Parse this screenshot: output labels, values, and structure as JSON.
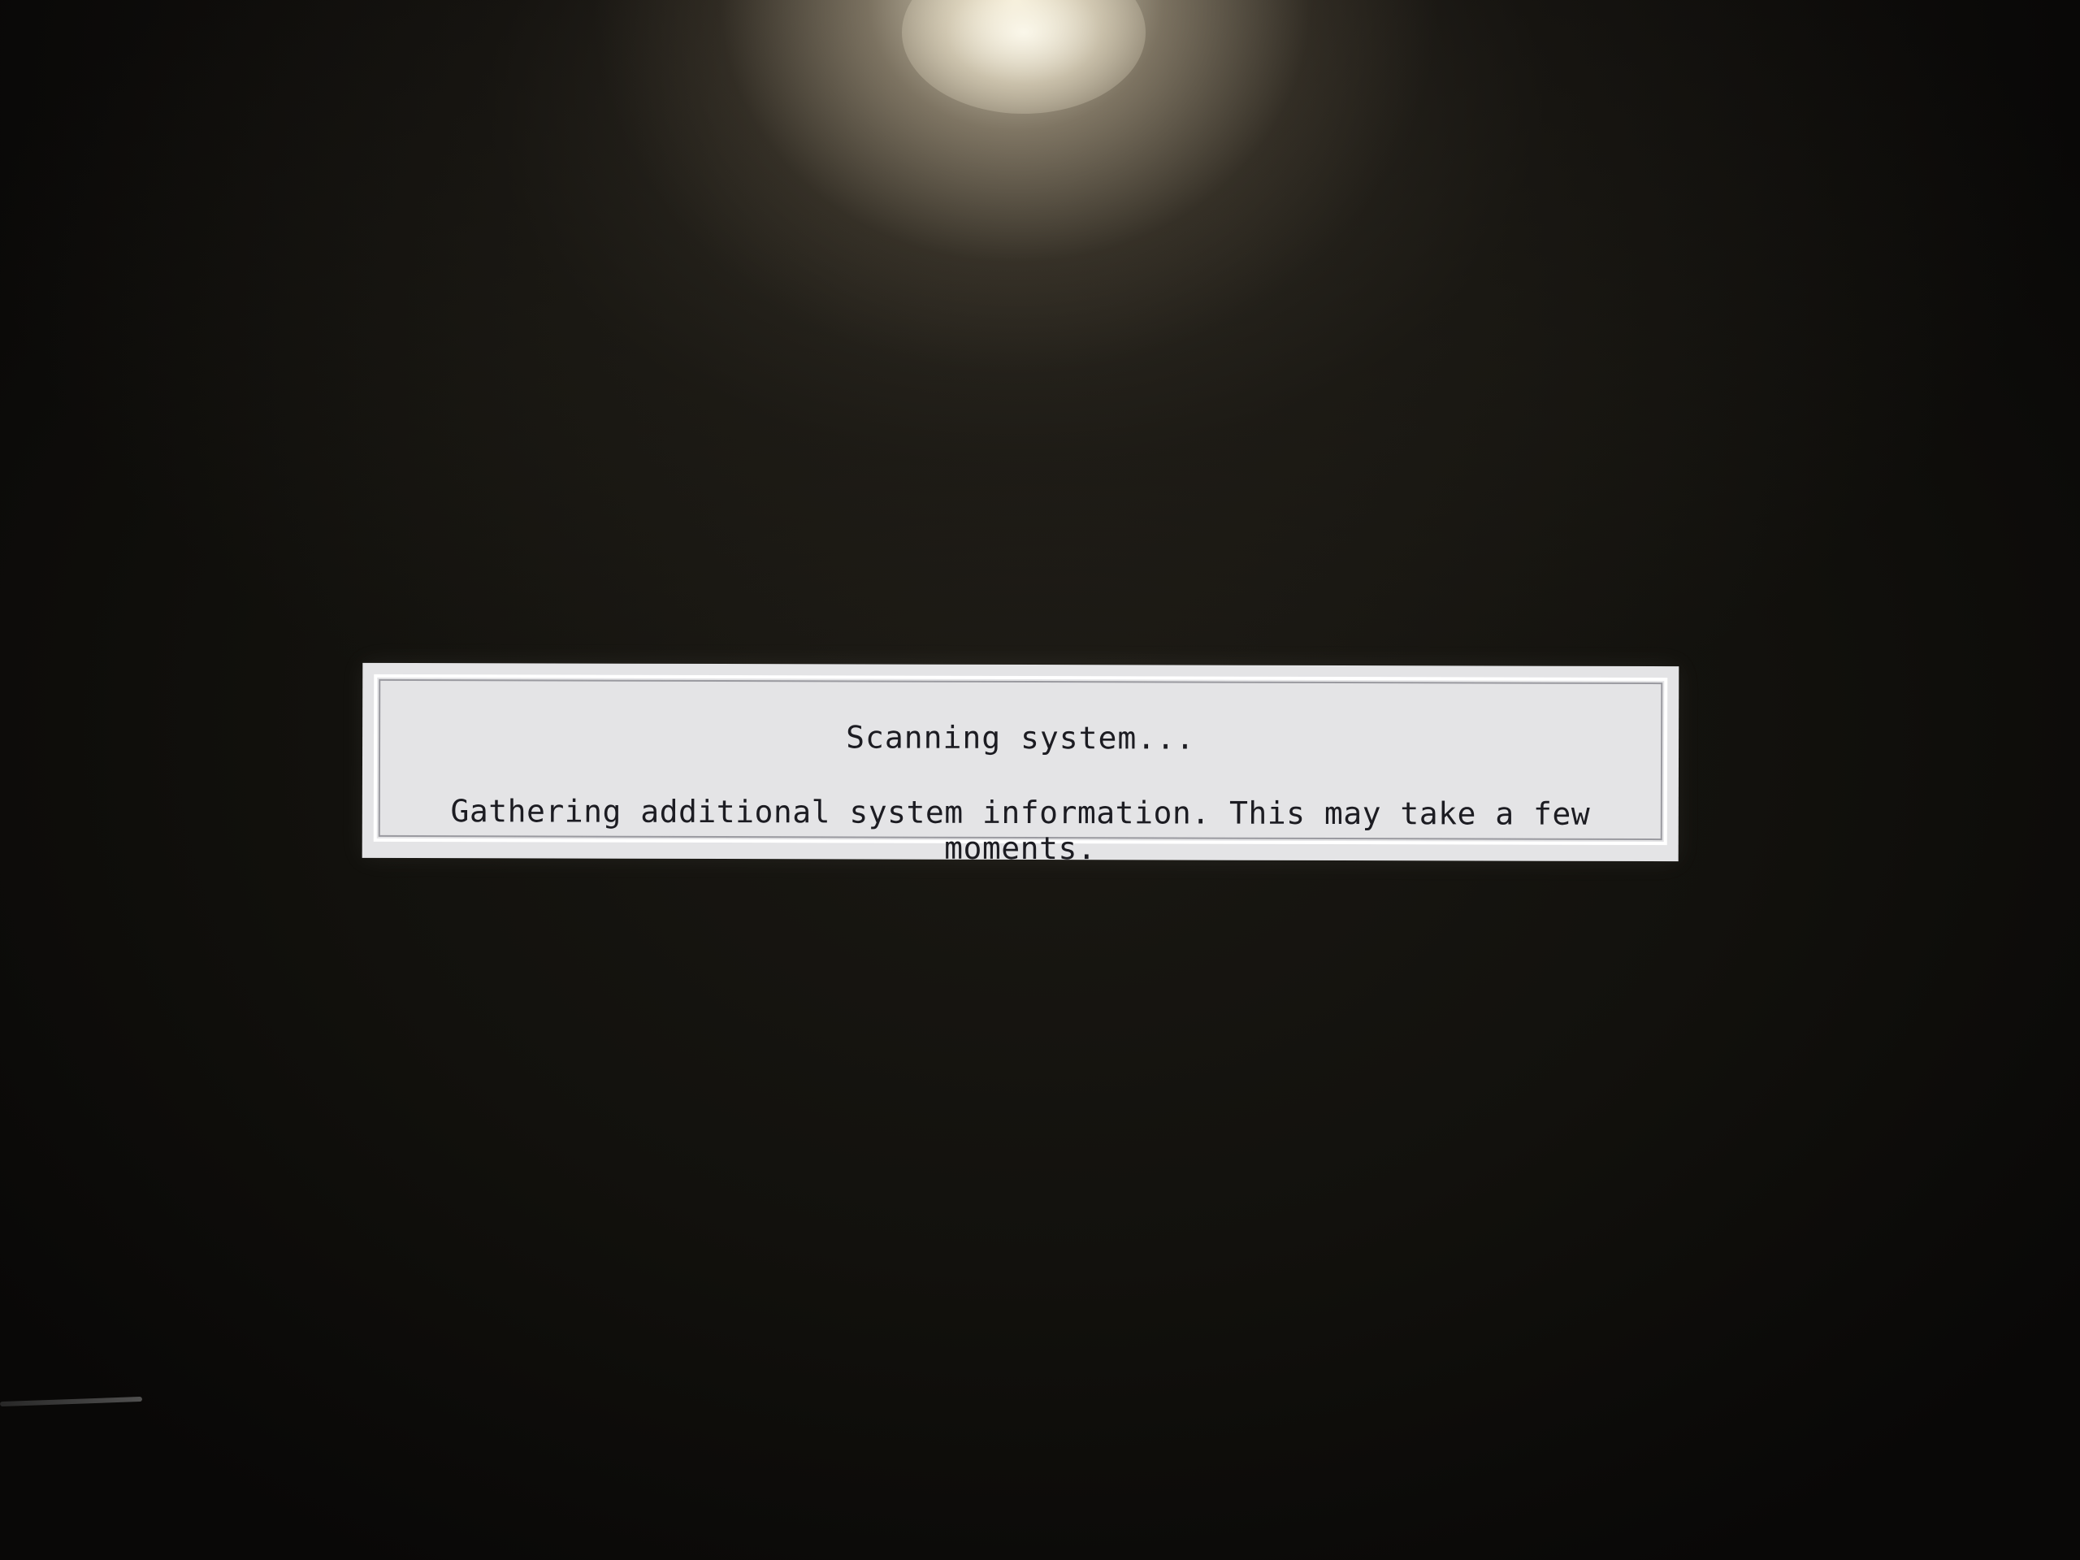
{
  "dialog": {
    "title": "Scanning system...",
    "message": "Gathering additional system information. This may take a few moments."
  },
  "colors": {
    "dialog_background": "#e4e4e6",
    "dialog_text": "#1c1c22",
    "screen_background": "#0c0b09"
  }
}
